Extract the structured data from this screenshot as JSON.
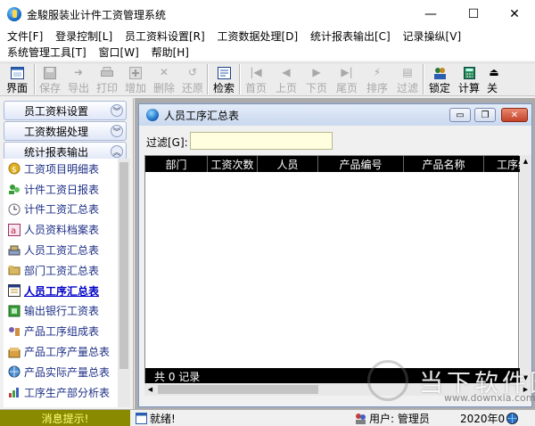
{
  "app": {
    "title": "金駿服装业计件工资管理系统",
    "win_minimize": "—",
    "win_maximize": "☐",
    "win_close": "✕"
  },
  "menu": [
    "文件[F]",
    "登录控制[L]",
    "员工资料设置[R]",
    "工资数据处理[D]",
    "统计报表输出[C]",
    "记录操纵[V]",
    "系统管理工具[T]",
    "窗口[W]",
    "帮助[H]"
  ],
  "toolbar": {
    "interface": "界面",
    "save": "保存",
    "export": "导出",
    "print": "打印",
    "add": "增加",
    "delete": "删除",
    "restore": "还原",
    "search": "检索",
    "first": "首页",
    "prev": "上页",
    "next": "下页",
    "last": "尾页",
    "sort": "排序",
    "filter": "过滤",
    "lock": "锁定",
    "calculate": "计算",
    "close": "关"
  },
  "sidebar": {
    "sections": [
      "员工资料设置",
      "工资数据处理",
      "统计报表输出"
    ],
    "items": [
      "工资项目明细表",
      "计件工资日报表",
      "计件工资汇总表",
      "人员资料档案表",
      "人员工资汇总表",
      "部门工资汇总表",
      "人员工序汇总表",
      "输出银行工资表",
      "产品工序组成表",
      "产品工序产量总表",
      "产品实际产量总表",
      "工序生产部分析表"
    ],
    "selected_index": 6
  },
  "child_window": {
    "title": "人员工序汇总表",
    "filter_label": "过滤[G]:",
    "filter_value": "",
    "columns": [
      "部门",
      "工资次数",
      "人员",
      "产品编号",
      "产品名称",
      "工序编"
    ],
    "footer": "共 0 记录"
  },
  "statusbar": {
    "message": "消息提示!",
    "ready": "就绪!",
    "user": "用户: 管理员",
    "date": "2020年0"
  },
  "watermark": {
    "text": "当下软件园",
    "url": "www.downxia.com"
  },
  "colors": {
    "status_msg_bg": "#8a8a00",
    "status_msg_fg": "#ffff7a",
    "grid_header_bg": "#000000",
    "sidebar_item_text": "#1c2f86"
  }
}
